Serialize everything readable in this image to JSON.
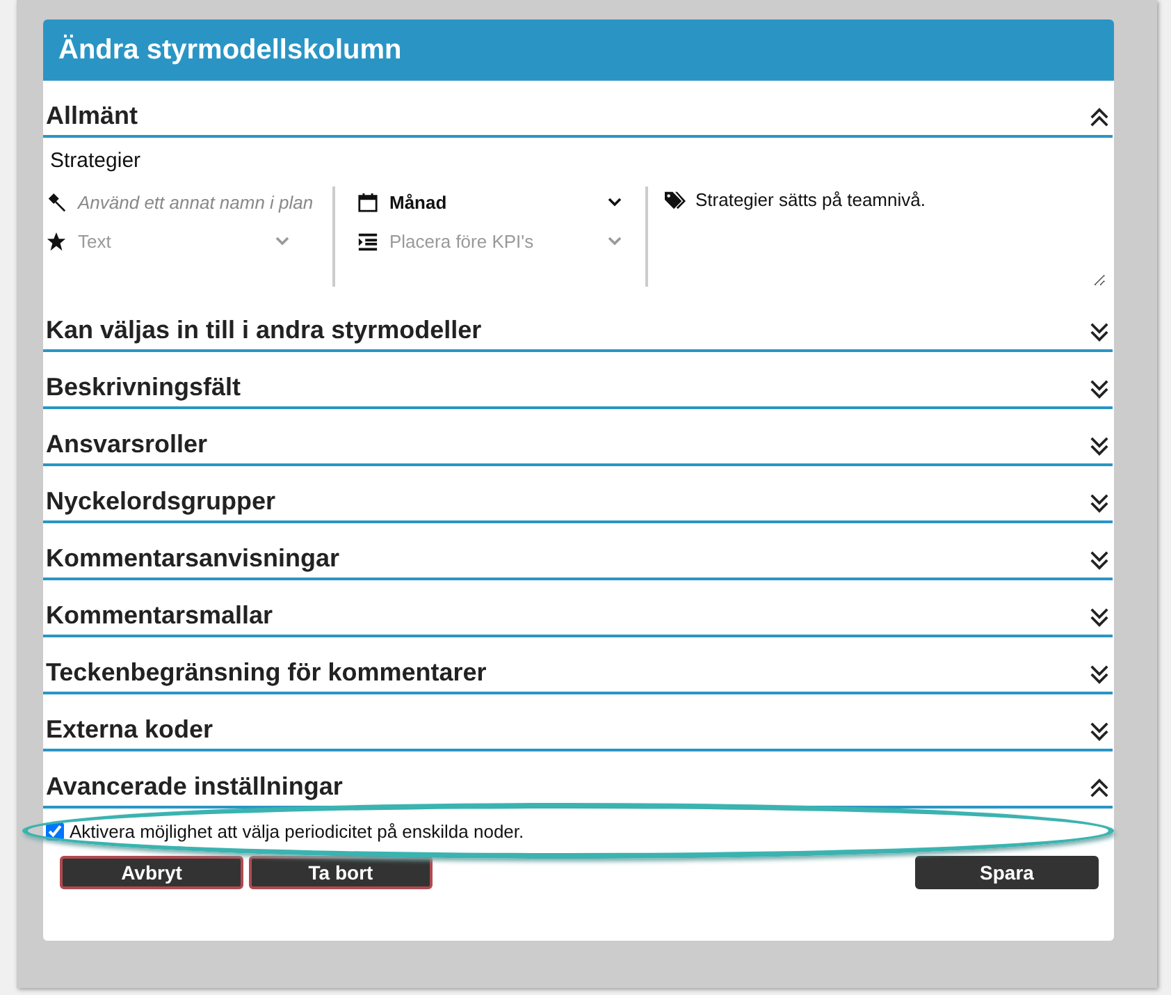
{
  "dialog": {
    "title": "Ändra styrmodellskolumn"
  },
  "sections": [
    {
      "title": "Allmänt",
      "expanded": true,
      "kind": "general"
    },
    {
      "title": "Kan väljas in till i andra styrmodeller",
      "expanded": false
    },
    {
      "title": "Beskrivningsfält",
      "expanded": false
    },
    {
      "title": "Ansvarsroller",
      "expanded": false
    },
    {
      "title": "Nyckelordsgrupper",
      "expanded": false
    },
    {
      "title": "Kommentarsanvisningar",
      "expanded": false
    },
    {
      "title": "Kommentarsmallar",
      "expanded": false
    },
    {
      "title": "Teckenbegränsning för kommentarer",
      "expanded": false
    },
    {
      "title": "Externa koder",
      "expanded": false
    },
    {
      "title": "Avancerade inställningar",
      "expanded": true,
      "kind": "advanced"
    }
  ],
  "general": {
    "name": "Strategier",
    "alt_name": {
      "placeholder": "Använd ett annat namn i plan"
    },
    "type": {
      "placeholder": "Text",
      "disabled": true
    },
    "period": {
      "value": "Månad"
    },
    "position": {
      "placeholder": "Placera före KPI's",
      "disabled": true
    },
    "description": "Strategier sätts på teamnivå."
  },
  "advanced": {
    "label": "Aktivera möjlighet att välja periodicitet på enskilda noder.",
    "checked": true,
    "highlighted": true
  },
  "buttons": [
    {
      "label": "Avbryt",
      "kind": "cancel"
    },
    {
      "label": "Ta bort",
      "kind": "delete"
    },
    {
      "label": "Spara",
      "kind": "save"
    }
  ]
}
